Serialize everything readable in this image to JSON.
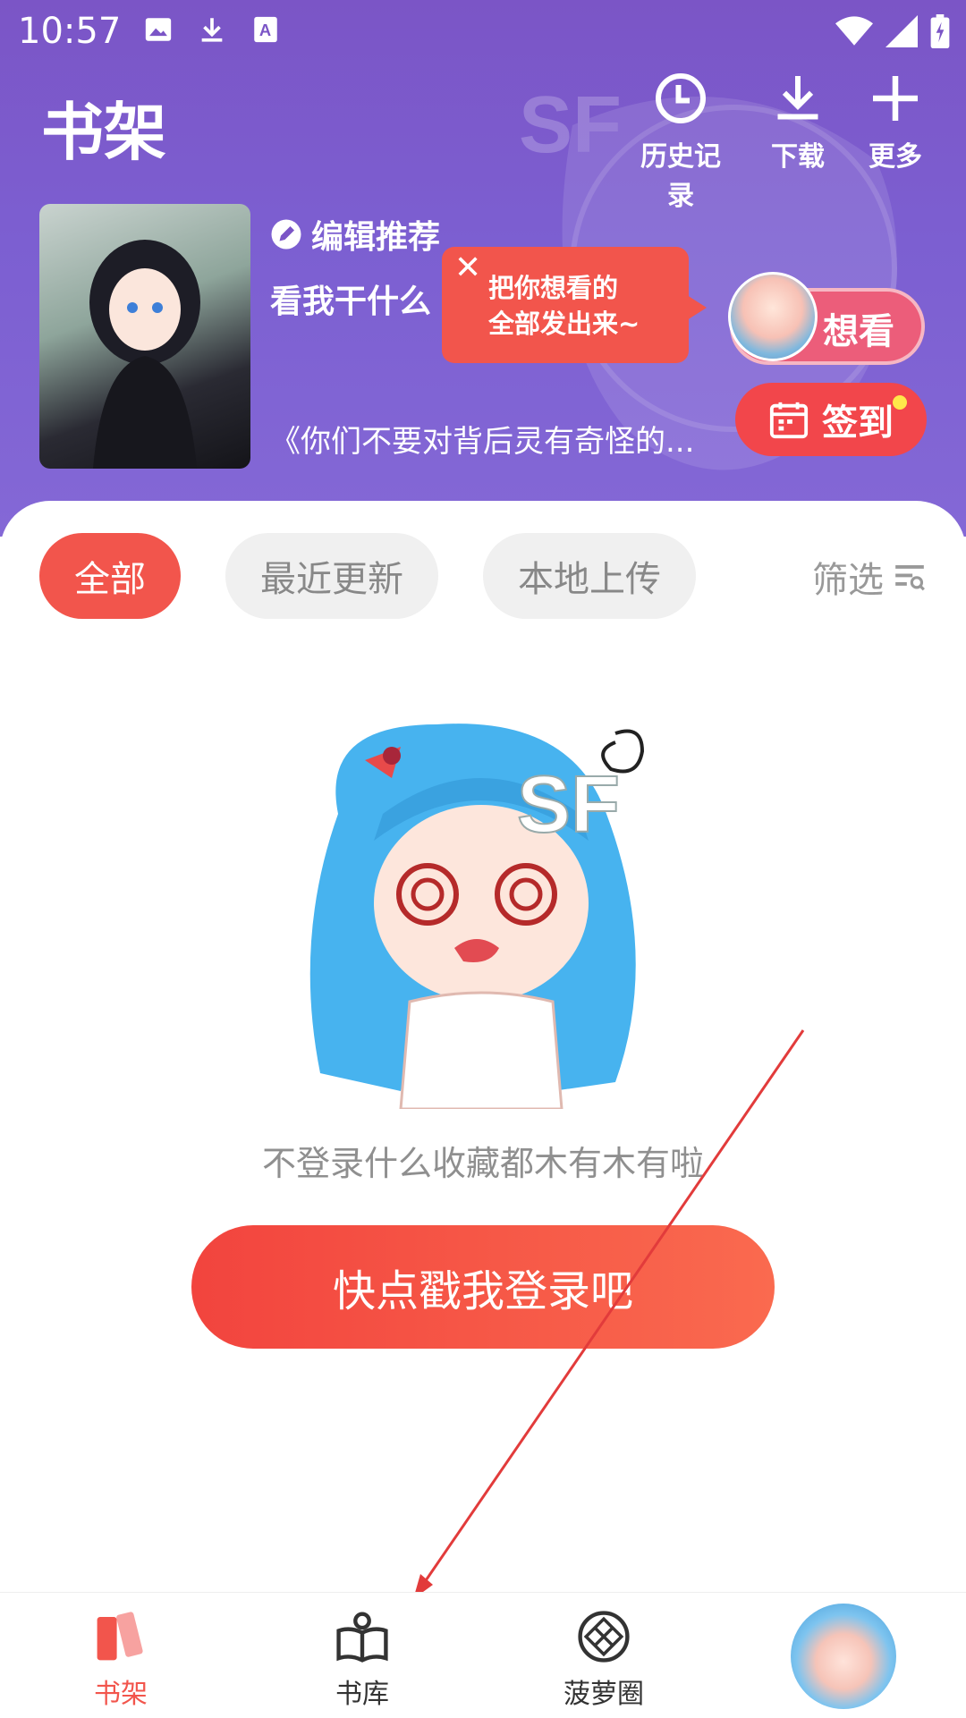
{
  "status_bar": {
    "time": "10:57",
    "left_icons": [
      "image-icon",
      "download-icon",
      "text-a-icon"
    ],
    "right_icons": [
      "wifi-icon",
      "signal-icon",
      "battery-icon"
    ]
  },
  "header": {
    "title": "书架",
    "actions": [
      {
        "label": "历史记录",
        "icon": "clock-icon"
      },
      {
        "label": "下载",
        "icon": "download-icon"
      },
      {
        "label": "更多",
        "icon": "plus-icon"
      }
    ]
  },
  "featured": {
    "label": "编辑推荐",
    "title": "看我干什么",
    "description": "《你们不要对背后灵有奇怪的..."
  },
  "tooltip": {
    "close": "✕",
    "line1": "把你想看的",
    "line2": "全部发出来~"
  },
  "want_button": {
    "label": "想看"
  },
  "sign_button": {
    "label": "签到"
  },
  "tabs": {
    "items": [
      "全部",
      "最近更新",
      "本地上传"
    ],
    "active_index": 0,
    "filter_label": "筛选"
  },
  "empty_state": {
    "message": "不登录什么收藏都木有木有啦",
    "login_button": "快点戳我登录吧"
  },
  "bottom_nav": {
    "items": [
      {
        "label": "书架",
        "icon": "bookshelf-icon",
        "active": true
      },
      {
        "label": "书库",
        "icon": "book-store-icon",
        "active": false
      },
      {
        "label": "菠萝圈",
        "icon": "community-icon",
        "active": false
      }
    ],
    "profile_icon": "profile-avatar"
  },
  "colors": {
    "header_purple": "#7c5fd1",
    "accent_red": "#f2554c",
    "want_pink": "#ec5d7a",
    "inactive_tab": "#f0f0f0"
  }
}
